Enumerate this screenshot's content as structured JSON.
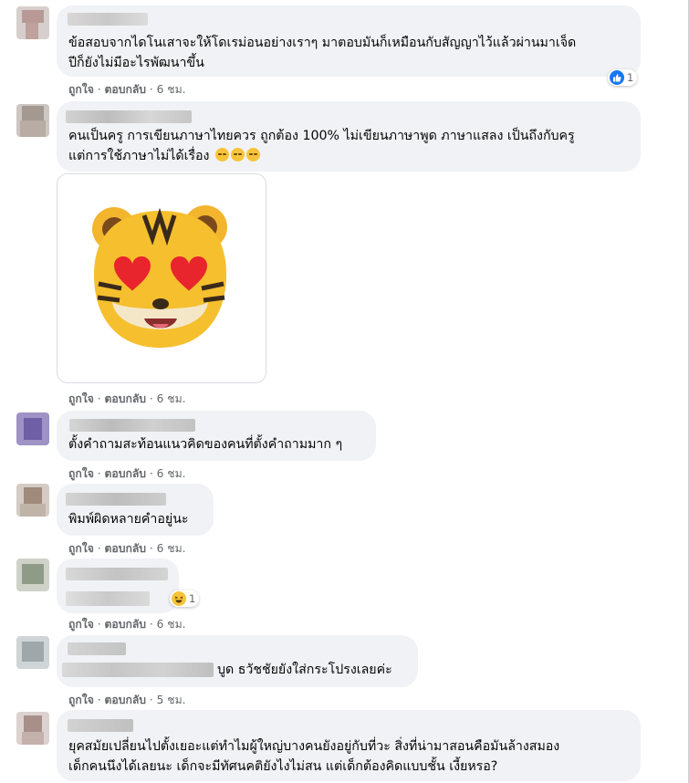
{
  "comments": [
    {
      "lines": [
        "ข้อสอบจากไดโนเสาจะให้โดเรม่อนอย่างเราๆ มาตอบมันก็เหมือนกับสัญญาไว้แล้วผ่านมาเจ็ด",
        "ปีก็ยังไม่มีอะไรพัฒนาขึ้น"
      ],
      "reaction_icon": "like-icon",
      "reaction_count": "1",
      "like": "ถูกใจ",
      "reply": "ตอบกลับ",
      "time": "6 ชม."
    },
    {
      "lines": [
        "คนเป็นครู การเขียนภาษาไทยควร ถูกต้อง 100% ไม่เขียนภาษาพูด ภาษาแสลง เป็นถึงกับครู",
        "แต่การใช้ภาษาไม่ได้เรื่อง"
      ],
      "emoji_icon": "pensive-face-icon",
      "sticker_icon": "tiger-heart-eyes-sticker",
      "like": "ถูกใจ",
      "reply": "ตอบกลับ",
      "time": "6 ชม."
    },
    {
      "lines": [
        "ตั้งคำถามสะท้อนแนวคิดของคนที่ตั้งคำถามมาก ๆ"
      ],
      "like": "ถูกใจ",
      "reply": "ตอบกลับ",
      "time": "6 ชม."
    },
    {
      "lines": [
        "พิมพ์ผิดหลายคำอยู่นะ"
      ],
      "like": "ถูกใจ",
      "reply": "ตอบกลับ",
      "time": "6 ชม."
    },
    {
      "reaction_icon": "haha-icon",
      "reaction_count": "1",
      "like": "ถูกใจ",
      "reply": "ตอบกลับ",
      "time": "6 ชม."
    },
    {
      "lines": [
        "บูด ธวัชชัยยังใส่กระโปรงเลยค่ะ"
      ],
      "like": "ถูกใจ",
      "reply": "ตอบกลับ",
      "time": "5 ชม."
    },
    {
      "lines": [
        "ยุคสมัยเปลี่ยนไปตั้งเยอะแต่ทำไมผู้ใหญ่บางคนยังอยู่กับที่วะ สิ่งที่น่ามาสอนคือมันล้างสมอง",
        "เด็กคนนึงได้เลยนะ เด็กจะมีทัศนคติยังไงไม่สน แต่เด็กต้องคิดแบบชั้น เงี้ยหรอ?"
      ]
    }
  ],
  "colors": {
    "like_blue": "#1877f2",
    "haha_yellow": "#f7c439",
    "bubble": "#f0f2f5",
    "meta": "#65676b"
  },
  "separator": "·"
}
